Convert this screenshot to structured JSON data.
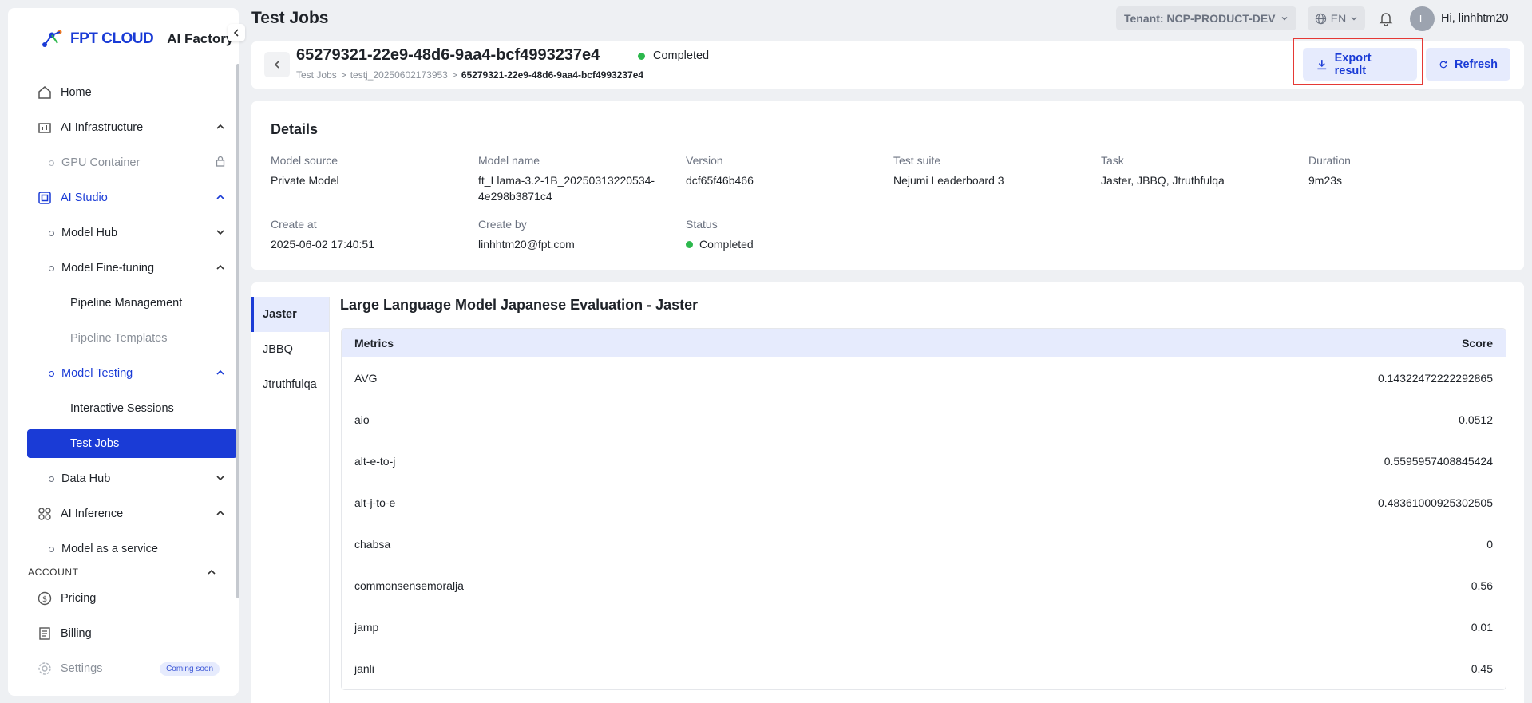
{
  "brand": {
    "logo_text": "FPT CLOUD",
    "product": "AI Factory"
  },
  "sidebar": {
    "home": "Home",
    "ai_infrastructure": "AI Infrastructure",
    "gpu_container": "GPU Container",
    "ai_studio": "AI Studio",
    "model_hub": "Model Hub",
    "model_fine_tuning": "Model Fine-tuning",
    "pipeline_management": "Pipeline Management",
    "pipeline_templates": "Pipeline Templates",
    "model_testing": "Model Testing",
    "interactive_sessions": "Interactive Sessions",
    "test_jobs": "Test Jobs",
    "data_hub": "Data Hub",
    "ai_inference": "AI Inference",
    "model_as_a_service": "Model as a service",
    "account_section": "ACCOUNT",
    "pricing": "Pricing",
    "billing": "Billing",
    "settings": "Settings",
    "coming_soon": "Coming soon"
  },
  "topbar": {
    "page_title": "Test Jobs",
    "tenant": "Tenant: NCP-PRODUCT-DEV",
    "language": "EN",
    "avatar_initial": "L",
    "greeting": "Hi, linhhtm20"
  },
  "job": {
    "id": "65279321-22e9-48d6-9aa4-bcf4993237e4",
    "status": "Completed",
    "breadcrumb": [
      "Test Jobs",
      ">",
      "testj_20250602173953",
      ">",
      "65279321-22e9-48d6-9aa4-bcf4993237e4"
    ],
    "export_label": "Export result",
    "refresh_label": "Refresh"
  },
  "details": {
    "title": "Details",
    "model_source_label": "Model source",
    "model_source": "Private Model",
    "model_name_label": "Model name",
    "model_name_line1": "ft_Llama-3.2-1B_20250313220534-",
    "model_name_line2": "4e298b3871c4",
    "version_label": "Version",
    "version": "dcf65f46b466",
    "test_suite_label": "Test suite",
    "test_suite": "Nejumi Leaderboard 3",
    "task_label": "Task",
    "task": "Jaster, JBBQ, Jtruthfulqa",
    "duration_label": "Duration",
    "duration": "9m23s",
    "create_at_label": "Create at",
    "create_at": "2025-06-02 17:40:51",
    "create_by_label": "Create by",
    "create_by": "linhhtm20@fpt.com",
    "status_label": "Status",
    "status": "Completed"
  },
  "results": {
    "tabs": [
      "Jaster",
      "JBBQ",
      "Jtruthfulqa"
    ],
    "title": "Large Language Model Japanese Evaluation - Jaster",
    "col_metrics": "Metrics",
    "col_score": "Score",
    "rows": [
      {
        "metric": "AVG",
        "score": "0.14322472222292865"
      },
      {
        "metric": "aio",
        "score": "0.0512"
      },
      {
        "metric": "alt-e-to-j",
        "score": "0.5595957408845424"
      },
      {
        "metric": "alt-j-to-e",
        "score": "0.48361000925302505"
      },
      {
        "metric": "chabsa",
        "score": "0"
      },
      {
        "metric": "commonsensemoralja",
        "score": "0.56"
      },
      {
        "metric": "jamp",
        "score": "0.01"
      },
      {
        "metric": "janli",
        "score": "0.45"
      }
    ]
  },
  "colors": {
    "primary": "#1a3bd6",
    "success": "#2db84d",
    "highlight": "#e53935"
  }
}
